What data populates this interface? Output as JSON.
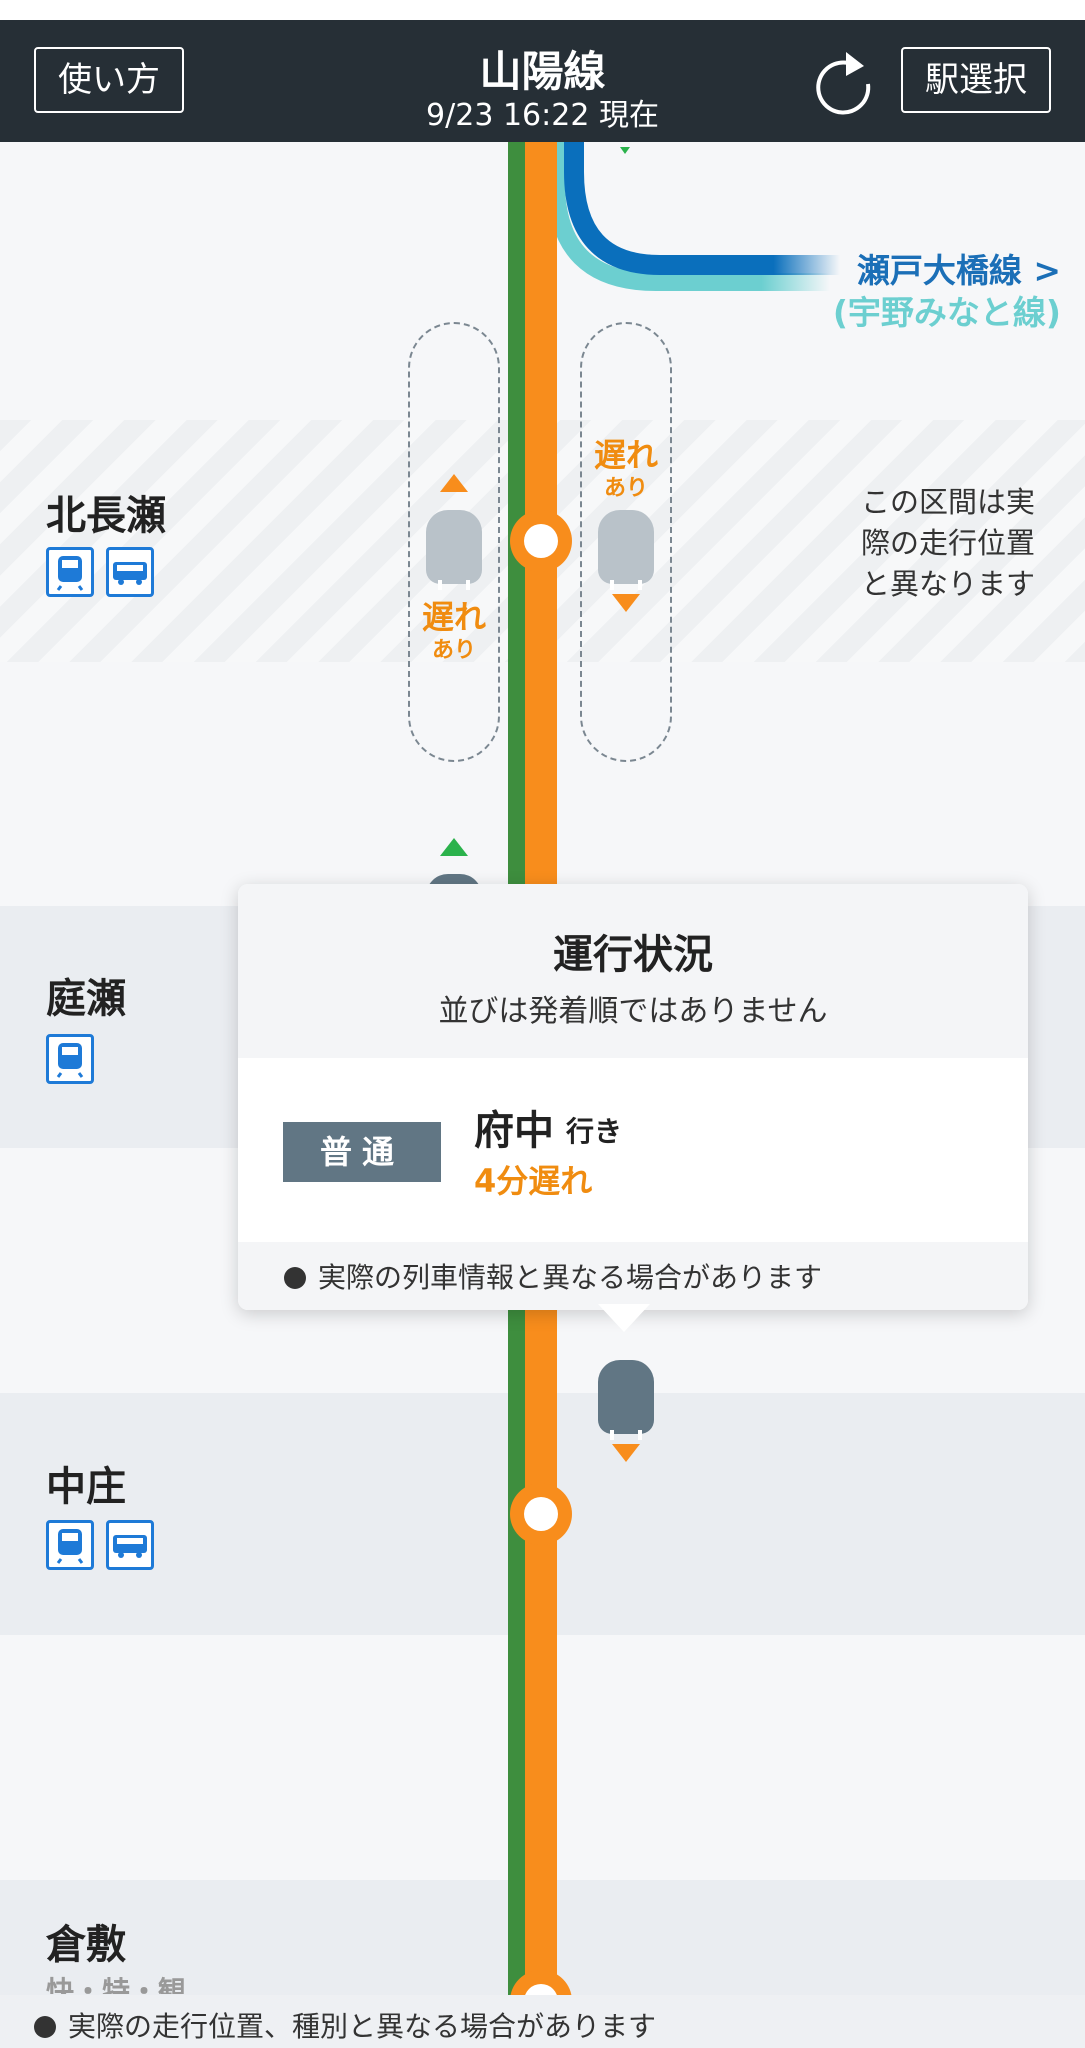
{
  "header": {
    "howto_label": "使い方",
    "line_name": "山陽線",
    "updated": "9/23 16:22 現在",
    "station_select_label": "駅選択"
  },
  "branch": {
    "label": "瀬戸大橋線 >",
    "sub_label": "(宇野みなと線)",
    "colors": {
      "seto_ohashi": "#0a6fbc",
      "uno_minato": "#6ccfd0"
    }
  },
  "colors": {
    "rail_green": "#3e8e3e",
    "rail_orange": "#f88d1c",
    "accent_delay": "#f08c10"
  },
  "stations": [
    {
      "name": "北長瀬",
      "icons": [
        "train-icon",
        "bus-icon"
      ]
    },
    {
      "name": "庭瀬",
      "icons": [
        "train-icon"
      ]
    },
    {
      "name": "中庄",
      "icons": [
        "train-icon",
        "bus-icon"
      ]
    },
    {
      "name": "倉敷",
      "partial_text": "快・特・観"
    }
  ],
  "section_note": "この区間は実際の走行位置と異なります",
  "delay_badges": [
    {
      "big": "遅れ",
      "small": "あり"
    },
    {
      "big": "遅れ",
      "small": "あり"
    }
  ],
  "popup": {
    "title": "運行状況",
    "subtitle": "並びは発着順ではありません",
    "train_type": "普通",
    "destination": "府中",
    "destination_suffix": "行き",
    "delay": "4分遅れ",
    "note": "実際の列車情報と異なる場合があります"
  },
  "footer": {
    "note": "実際の走行位置、種別と異なる場合があります"
  }
}
